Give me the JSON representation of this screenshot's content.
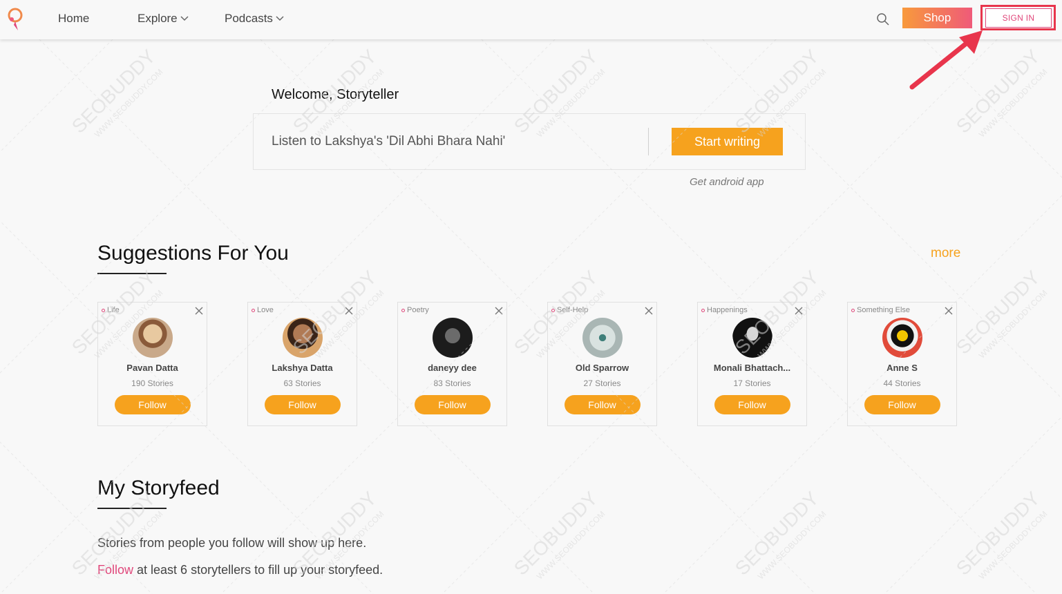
{
  "nav": {
    "home": "Home",
    "explore": "Explore",
    "podcasts": "Podcasts",
    "shop": "Shop",
    "sign_in": "SIGN IN"
  },
  "welcome": {
    "title": "Welcome, Storyteller",
    "prompt": "Listen to Lakshya's 'Dil Abhi Bhara Nahi'",
    "start_writing": "Start writing",
    "android_link": "Get android app"
  },
  "suggestions": {
    "title": "Suggestions For You",
    "more": "more",
    "cards": [
      {
        "tag": "Life",
        "name": "Pavan Datta",
        "stories": "190 Stories",
        "follow": "Follow"
      },
      {
        "tag": "Love",
        "name": "Lakshya Datta",
        "stories": "63 Stories",
        "follow": "Follow"
      },
      {
        "tag": "Poetry",
        "name": "daneyy dee",
        "stories": "83 Stories",
        "follow": "Follow"
      },
      {
        "tag": "Self-Help",
        "name": "Old Sparrow",
        "stories": "27 Stories",
        "follow": "Follow"
      },
      {
        "tag": "Happenings",
        "name": "Monali Bhattach...",
        "stories": "17 Stories",
        "follow": "Follow"
      },
      {
        "tag": "Something Else",
        "name": "Anne S",
        "stories": "44 Stories",
        "follow": "Follow"
      }
    ]
  },
  "storyfeed": {
    "title": "My Storyfeed",
    "line1": "Stories from people you follow will show up here.",
    "follow_word": "Follow",
    "line2_rest": " at least 6 storytellers to fill up your storyfeed."
  },
  "watermark": {
    "brand": "SEOBUDDY",
    "url": "WWW.SEOBUDDY.COM"
  },
  "colors": {
    "accent_orange": "#f6a21e",
    "accent_pink": "#e0467a",
    "highlight_red": "#e8354c"
  }
}
